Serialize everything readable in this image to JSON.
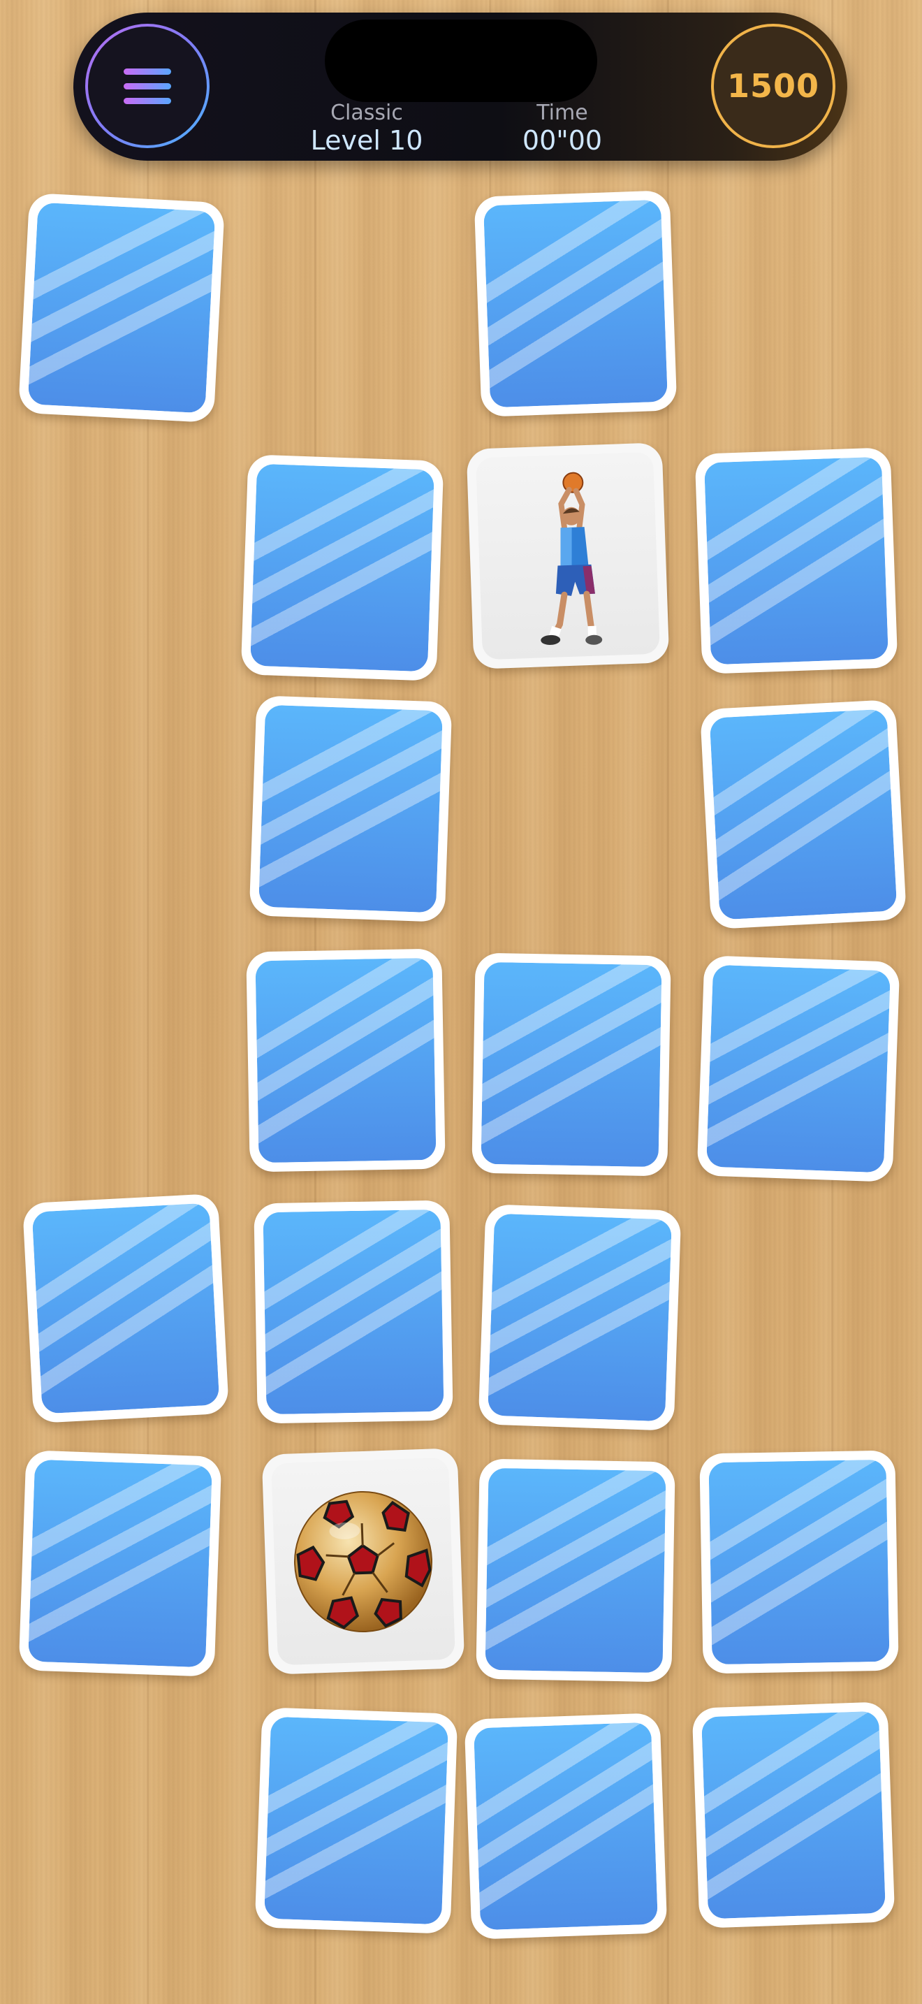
{
  "hud": {
    "mode_label": "Classic",
    "level_text": "Level 10",
    "time_label": "Time",
    "time_value": "00\"00",
    "coins": "1500",
    "menu_icon": "hamburger-menu-icon"
  },
  "colors": {
    "card_back_top": "#5bb6fb",
    "card_back_bottom": "#4d8ee8",
    "coins_accent": "#f3b64a",
    "menu_gradient": [
      "#c96cf5",
      "#5aa6ff"
    ]
  },
  "board": {
    "cards": [
      {
        "state": "face-down"
      },
      {
        "state": "face-down"
      },
      {
        "state": "face-down"
      },
      {
        "state": "revealed",
        "image": "basketball-player"
      },
      {
        "state": "face-down"
      },
      {
        "state": "face-down"
      },
      {
        "state": "face-down"
      },
      {
        "state": "face-down"
      },
      {
        "state": "face-down"
      },
      {
        "state": "face-down"
      },
      {
        "state": "face-down"
      },
      {
        "state": "face-down"
      },
      {
        "state": "face-down"
      },
      {
        "state": "face-down"
      },
      {
        "state": "revealed",
        "image": "soccer-ball"
      },
      {
        "state": "face-down"
      },
      {
        "state": "face-down"
      },
      {
        "state": "face-down"
      },
      {
        "state": "face-down"
      },
      {
        "state": "face-down"
      }
    ]
  }
}
